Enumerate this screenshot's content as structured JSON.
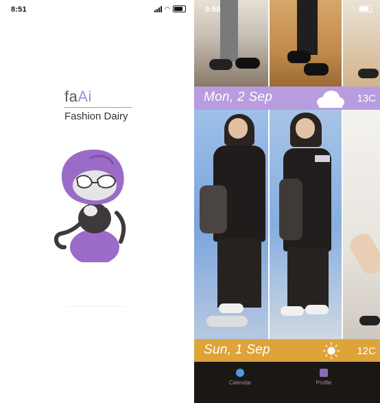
{
  "splash": {
    "status_time": "8:51",
    "logo_prefix": "fa",
    "logo_ai": "Ai",
    "subtitle": "Fashion Dairy"
  },
  "feed": {
    "status_time": "9:50",
    "days": [
      {
        "label": "Mon, 2 Sep",
        "temp": "13C",
        "weather_icon": "cloud-icon"
      },
      {
        "label": "Sun, 1 Sep",
        "temp": "12C",
        "weather_icon": "sun-icon"
      }
    ],
    "tabs": [
      {
        "label": "Calendar",
        "icon": "calendar-icon"
      },
      {
        "label": "Profile",
        "icon": "profile-icon"
      }
    ]
  },
  "colors": {
    "brand_purple": "#b79ddf",
    "sunday_orange": "#dea339",
    "tabbar_bg": "#1a1715",
    "tab_icon_blue": "#4a9be0",
    "tab_icon_purple": "#8b6bb8"
  }
}
